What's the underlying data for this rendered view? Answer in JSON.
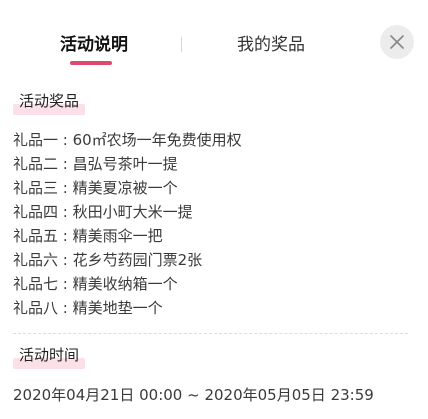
{
  "tabs": [
    {
      "label": "活动说明",
      "active": true
    },
    {
      "label": "我的奖品",
      "active": false
    }
  ],
  "close_icon": "close-icon",
  "colors": {
    "accent": "#e0476f",
    "highlight": "#fbe0e8"
  },
  "prizes_section": {
    "title": "活动奖品",
    "items": [
      "礼品一 : 60㎡农场一年免费使用权",
      "礼品二 : 昌弘号茶叶一提",
      "礼品三 : 精美夏凉被一个",
      "礼品四 : 秋田小町大米一提",
      "礼品五 : 精美雨伞一把",
      "礼品六 : 花乡芍药园门票2张",
      "礼品七 : 精美收纳箱一个",
      "礼品八 : 精美地垫一个"
    ]
  },
  "time_section": {
    "title": "活动时间",
    "text": "2020年04月21日 00:00 ~ 2020年05月05日 23:59"
  }
}
